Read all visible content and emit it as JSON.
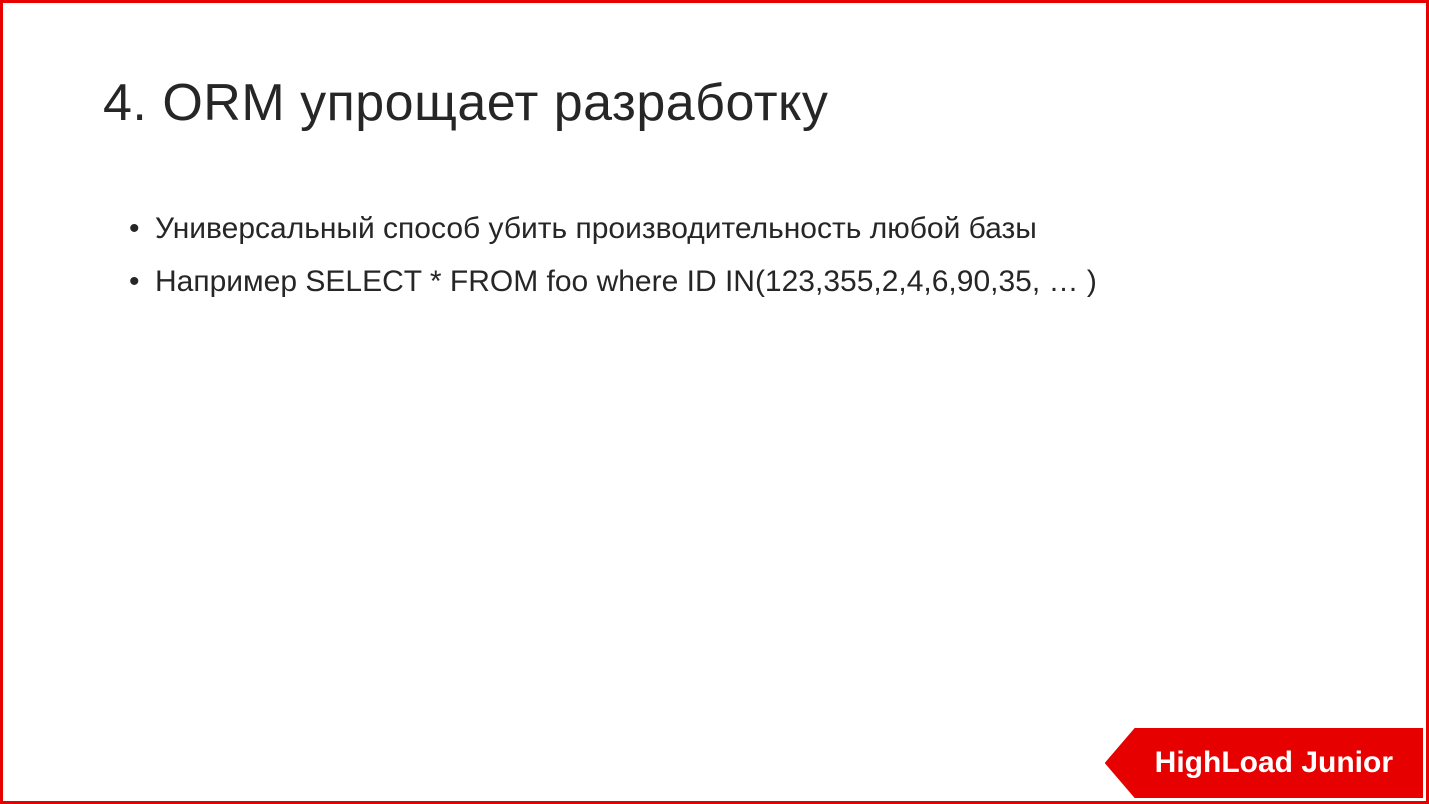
{
  "slide": {
    "title": "4. ORM упрощает разработку",
    "bullets": [
      "Универсальный способ убить производительность любой базы",
      "Например SELECT * FROM foo where ID IN(123,355,2,4,6,90,35,  … )"
    ]
  },
  "logo": {
    "text": "HighLoad Junior"
  }
}
